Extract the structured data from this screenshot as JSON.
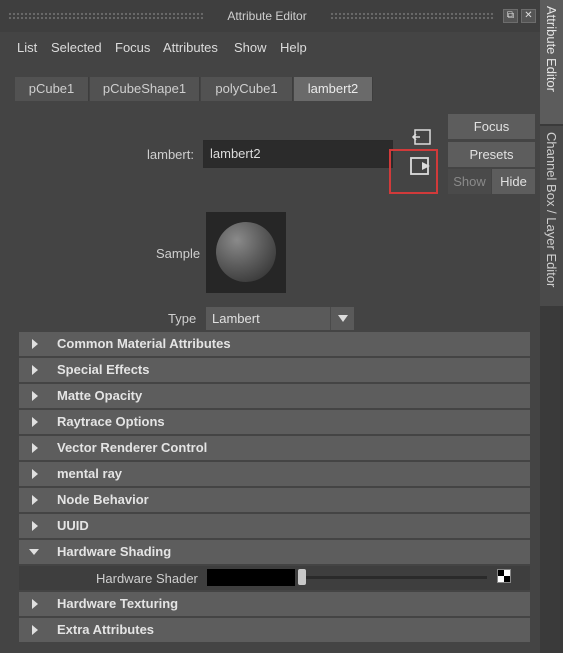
{
  "window": {
    "title": "Attribute Editor",
    "float_icon": "float-window-icon",
    "close_icon": "close-icon",
    "float_glyph": "⧉",
    "close_glyph": "✕"
  },
  "menu": [
    "List",
    "Selected",
    "Focus",
    "Attributes",
    "Show",
    "Help"
  ],
  "tabs": [
    {
      "label": "pCube1",
      "active": false
    },
    {
      "label": "pCubeShape1",
      "active": false
    },
    {
      "label": "polyCube1",
      "active": false
    },
    {
      "label": "lambert2",
      "active": true
    }
  ],
  "node": {
    "label": "lambert:",
    "value": "lambert2",
    "input_connection_icon": "go-to-input-icon",
    "output_connection_icon": "go-to-output-icon"
  },
  "side_buttons": {
    "focus": "Focus",
    "presets": "Presets",
    "show": "Show",
    "hide": "Hide"
  },
  "sample": {
    "label": "Sample",
    "icon": "material-sample-sphere"
  },
  "type_select": {
    "label": "Type",
    "value": "Lambert"
  },
  "sections": [
    {
      "label": "Common Material Attributes",
      "expanded": false
    },
    {
      "label": "Special Effects",
      "expanded": false
    },
    {
      "label": "Matte Opacity",
      "expanded": false
    },
    {
      "label": "Raytrace Options",
      "expanded": false
    },
    {
      "label": "Vector Renderer Control",
      "expanded": false
    },
    {
      "label": "mental ray",
      "expanded": false
    },
    {
      "label": "Node Behavior",
      "expanded": false
    },
    {
      "label": "UUID",
      "expanded": false
    },
    {
      "label": "Hardware Shading",
      "expanded": true
    },
    {
      "label": "Hardware Texturing",
      "expanded": false
    },
    {
      "label": "Extra Attributes",
      "expanded": false
    }
  ],
  "hardware_shader": {
    "label": "Hardware Shader",
    "color": "#000000",
    "slider_value": 0,
    "map_icon": "checker-map-icon"
  },
  "side_tabs": [
    {
      "label": "Attribute Editor",
      "active": true
    },
    {
      "label": "Channel Box / Layer Editor",
      "active": false
    }
  ],
  "colors": {
    "highlight_box": "#d13a3a",
    "background": "#444444"
  }
}
